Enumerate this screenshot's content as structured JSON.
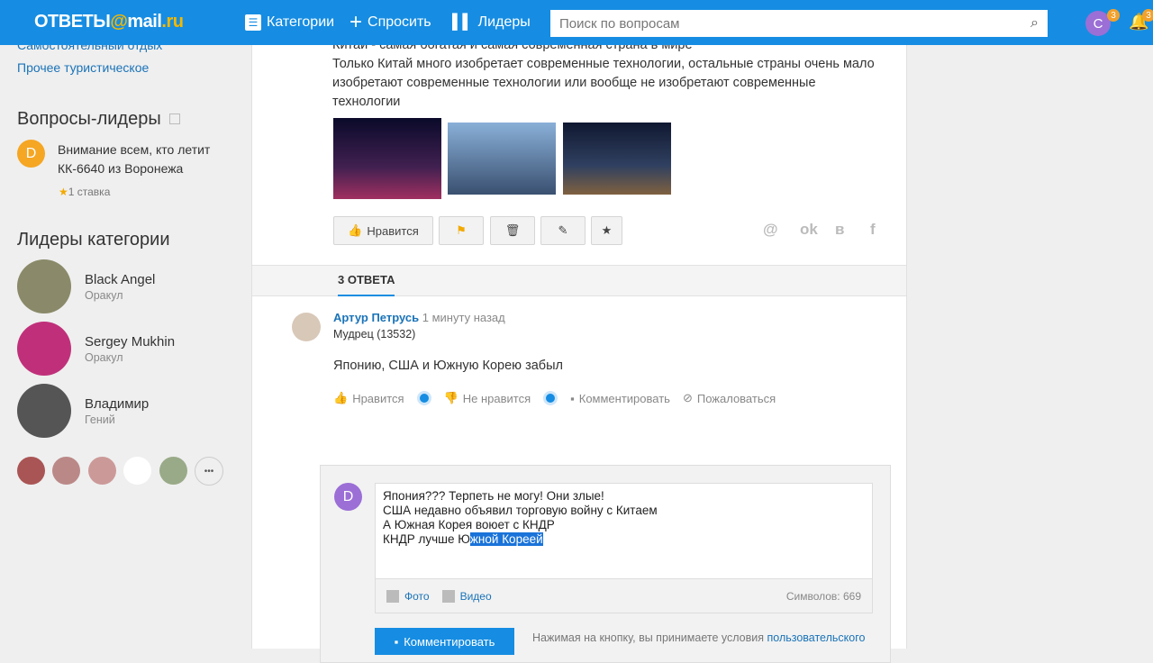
{
  "header": {
    "logo_text": "ОТВЕТЫ",
    "logo_at": "@",
    "logo_mail": "mail",
    "logo_ru": ".ru",
    "nav": [
      {
        "label": "Категории",
        "icon": "list-icon"
      },
      {
        "label": "Спросить",
        "icon": "plus-icon"
      },
      {
        "label": "Лидеры",
        "icon": "bar-chart-icon"
      }
    ],
    "search_placeholder": "Поиск по вопросам",
    "user_initial": "С",
    "user_badge": "3",
    "notif_badge": "3"
  },
  "sidebar": {
    "links": [
      "Самостоятельный отдых",
      "Прочее туристическое"
    ],
    "leader_questions_title": "Вопросы-лидеры",
    "leader_question": {
      "initial": "D",
      "text": "Внимание всем, кто летит КК-6640 из Воронежа",
      "stakes": "1 ставка"
    },
    "category_leaders_title": "Лидеры категории",
    "leaders": [
      {
        "name": "Black Angel",
        "rank": "Оракул"
      },
      {
        "name": "Sergey Mukhin",
        "rank": "Оракул"
      },
      {
        "name": "Владимир",
        "rank": "Гений"
      }
    ],
    "more": "•••"
  },
  "question": {
    "lines": [
      "Китай - самая богатая и самая современная страна в мире",
      "Только Китай много изобретает современные технологии, остальные страны очень мало изобретают современные технологии или вообще не изобретают современные технологии"
    ],
    "like_label": "Нравится"
  },
  "answers_tab": "3 ОТВЕТА",
  "answer": {
    "author": "Артур Петрусь",
    "time": "1 минуту назад",
    "rank": "Мудрец (13532)",
    "text": "Японию, США и Южную Корею забыл",
    "like": "Нравится",
    "dislike": "Не нравится",
    "comment": "Комментировать",
    "report": "Пожаловаться"
  },
  "comment_form": {
    "initial": "D",
    "lines": [
      "Япония??? Терпеть не могу! Они злые!",
      "США недавно объявил торговую войну с Китаем",
      "А Южная Корея воюет с КНДР"
    ],
    "last_line_plain": "КНДР лучше Ю",
    "last_line_selected": "жной Кореей",
    "photo": "Фото",
    "video": "Видео",
    "chars": "Символов: 669",
    "submit": "Комментировать",
    "terms": "Нажимая на кнопку, вы принимаете условия",
    "terms_link": "пользовательского"
  },
  "colors": {
    "brand": "#168de2",
    "link": "#1a73b8"
  }
}
